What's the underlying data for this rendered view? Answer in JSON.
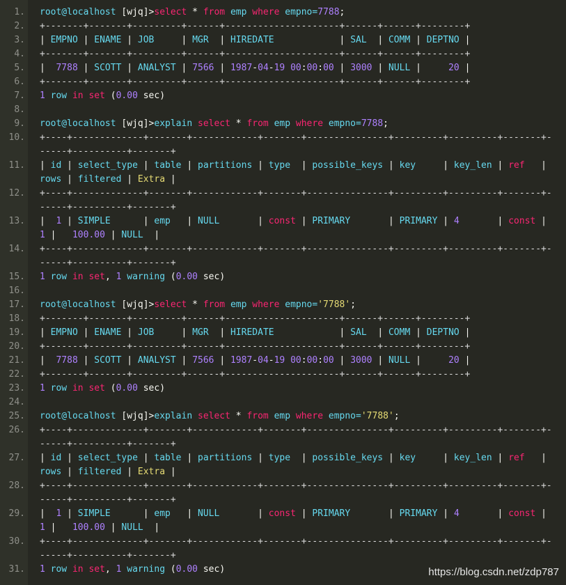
{
  "lines": [
    {
      "num": "1.",
      "tokens": [
        [
          "root@localhost ",
          "kw"
        ],
        [
          "[wjq]>",
          "plain"
        ],
        [
          "select",
          "pink"
        ],
        [
          " * ",
          "plain"
        ],
        [
          "from",
          "pink"
        ],
        [
          " emp ",
          "kw"
        ],
        [
          "where",
          "pink"
        ],
        [
          " empno=",
          "kw"
        ],
        [
          "7788",
          "num"
        ],
        [
          ";",
          "plain"
        ]
      ]
    },
    {
      "num": "2.",
      "tokens": [
        [
          "+-------+-------+---------+------+---------------------+------+------+--------+",
          "dash"
        ]
      ]
    },
    {
      "num": "3.",
      "tokens": [
        [
          "| ",
          "plain"
        ],
        [
          "EMPNO",
          "kw"
        ],
        [
          " | ",
          "plain"
        ],
        [
          "ENAME",
          "kw"
        ],
        [
          " | ",
          "plain"
        ],
        [
          "JOB",
          "kw"
        ],
        [
          "     | ",
          "plain"
        ],
        [
          "MGR",
          "kw"
        ],
        [
          "  | ",
          "plain"
        ],
        [
          "HIREDATE",
          "kw"
        ],
        [
          "            | ",
          "plain"
        ],
        [
          "SAL",
          "kw"
        ],
        [
          "  | ",
          "plain"
        ],
        [
          "COMM",
          "kw"
        ],
        [
          " | ",
          "plain"
        ],
        [
          "DEPTNO",
          "kw"
        ],
        [
          " |",
          "plain"
        ]
      ]
    },
    {
      "num": "4.",
      "tokens": [
        [
          "+-------+-------+---------+------+---------------------+------+------+--------+",
          "dash"
        ]
      ]
    },
    {
      "num": "5.",
      "tokens": [
        [
          "|  ",
          "plain"
        ],
        [
          "7788",
          "num"
        ],
        [
          " | ",
          "plain"
        ],
        [
          "SCOTT",
          "kw"
        ],
        [
          " | ",
          "plain"
        ],
        [
          "ANALYST",
          "kw"
        ],
        [
          " | ",
          "plain"
        ],
        [
          "7566",
          "num"
        ],
        [
          " | ",
          "plain"
        ],
        [
          "1987",
          "num"
        ],
        [
          "-",
          "plain"
        ],
        [
          "04",
          "num"
        ],
        [
          "-",
          "plain"
        ],
        [
          "19",
          "num"
        ],
        [
          " ",
          "plain"
        ],
        [
          "00",
          "num"
        ],
        [
          ":",
          "plain"
        ],
        [
          "00",
          "num"
        ],
        [
          ":",
          "plain"
        ],
        [
          "00",
          "num"
        ],
        [
          " | ",
          "plain"
        ],
        [
          "3000",
          "num"
        ],
        [
          " | ",
          "plain"
        ],
        [
          "NULL",
          "kw"
        ],
        [
          " |     ",
          "plain"
        ],
        [
          "20",
          "num"
        ],
        [
          " |",
          "plain"
        ]
      ]
    },
    {
      "num": "6.",
      "tokens": [
        [
          "+-------+-------+---------+------+---------------------+------+------+--------+",
          "dash"
        ]
      ]
    },
    {
      "num": "7.",
      "tokens": [
        [
          "1",
          "num"
        ],
        [
          " row ",
          "kw"
        ],
        [
          "in",
          "pink"
        ],
        [
          " ",
          "plain"
        ],
        [
          "set",
          "pink"
        ],
        [
          " (",
          "plain"
        ],
        [
          "0.00",
          "num"
        ],
        [
          " sec)",
          "plain"
        ]
      ]
    },
    {
      "num": "8.",
      "tokens": []
    },
    {
      "num": "9.",
      "tokens": [
        [
          "root@localhost ",
          "kw"
        ],
        [
          "[wjq]>",
          "plain"
        ],
        [
          "explain ",
          "kw"
        ],
        [
          "select",
          "pink"
        ],
        [
          " * ",
          "plain"
        ],
        [
          "from",
          "pink"
        ],
        [
          " emp ",
          "kw"
        ],
        [
          "where",
          "pink"
        ],
        [
          " empno=",
          "kw"
        ],
        [
          "7788",
          "num"
        ],
        [
          ";",
          "plain"
        ]
      ]
    },
    {
      "num": "10.",
      "tokens": [
        [
          "+----+-------------+-------+------------+-------+---------------+---------+---------+-------+------+----------+-------+",
          "dash"
        ]
      ]
    },
    {
      "num": "11.",
      "tokens": [
        [
          "| ",
          "plain"
        ],
        [
          "id",
          "kw"
        ],
        [
          " | ",
          "plain"
        ],
        [
          "select_type",
          "kw"
        ],
        [
          " | ",
          "plain"
        ],
        [
          "table",
          "kw"
        ],
        [
          " | ",
          "plain"
        ],
        [
          "partitions",
          "kw"
        ],
        [
          " | ",
          "plain"
        ],
        [
          "type",
          "kw"
        ],
        [
          "  | ",
          "plain"
        ],
        [
          "possible_keys",
          "kw"
        ],
        [
          " | ",
          "plain"
        ],
        [
          "key",
          "kw"
        ],
        [
          "     | ",
          "plain"
        ],
        [
          "key_len",
          "kw"
        ],
        [
          " | ",
          "plain"
        ],
        [
          "ref",
          "pink"
        ],
        [
          "   | ",
          "plain"
        ],
        [
          "rows",
          "kw"
        ],
        [
          " | ",
          "plain"
        ],
        [
          "filtered",
          "kw"
        ],
        [
          " | ",
          "plain"
        ],
        [
          "Extra",
          "str"
        ],
        [
          " |",
          "plain"
        ]
      ]
    },
    {
      "num": "12.",
      "tokens": [
        [
          "+----+-------------+-------+------------+-------+---------------+---------+---------+-------+------+----------+-------+",
          "dash"
        ]
      ]
    },
    {
      "num": "13.",
      "tokens": [
        [
          "|  ",
          "plain"
        ],
        [
          "1",
          "num"
        ],
        [
          " | ",
          "plain"
        ],
        [
          "SIMPLE",
          "kw"
        ],
        [
          "      | ",
          "plain"
        ],
        [
          "emp",
          "kw"
        ],
        [
          "   | ",
          "plain"
        ],
        [
          "NULL",
          "kw"
        ],
        [
          "       | ",
          "plain"
        ],
        [
          "const",
          "pink"
        ],
        [
          " | ",
          "plain"
        ],
        [
          "PRIMARY",
          "kw"
        ],
        [
          "       | ",
          "plain"
        ],
        [
          "PRIMARY",
          "kw"
        ],
        [
          " | ",
          "plain"
        ],
        [
          "4",
          "num"
        ],
        [
          "       | ",
          "plain"
        ],
        [
          "const",
          "pink"
        ],
        [
          " |    ",
          "plain"
        ],
        [
          "1",
          "num"
        ],
        [
          " |   ",
          "plain"
        ],
        [
          "100.00",
          "num"
        ],
        [
          " | ",
          "plain"
        ],
        [
          "NULL",
          "kw"
        ],
        [
          "  |",
          "plain"
        ]
      ]
    },
    {
      "num": "14.",
      "tokens": [
        [
          "+----+-------------+-------+------------+-------+---------------+---------+---------+-------+------+----------+-------+",
          "dash"
        ]
      ]
    },
    {
      "num": "15.",
      "tokens": [
        [
          "1",
          "num"
        ],
        [
          " row ",
          "kw"
        ],
        [
          "in",
          "pink"
        ],
        [
          " ",
          "plain"
        ],
        [
          "set",
          "pink"
        ],
        [
          ", ",
          "plain"
        ],
        [
          "1",
          "num"
        ],
        [
          " warning ",
          "kw"
        ],
        [
          "(",
          "plain"
        ],
        [
          "0.00",
          "num"
        ],
        [
          " sec)",
          "plain"
        ]
      ]
    },
    {
      "num": "16.",
      "tokens": []
    },
    {
      "num": "17.",
      "tokens": [
        [
          "root@localhost ",
          "kw"
        ],
        [
          "[wjq]>",
          "plain"
        ],
        [
          "select",
          "pink"
        ],
        [
          " * ",
          "plain"
        ],
        [
          "from",
          "pink"
        ],
        [
          " emp ",
          "kw"
        ],
        [
          "where",
          "pink"
        ],
        [
          " empno=",
          "kw"
        ],
        [
          "'7788'",
          "str"
        ],
        [
          ";",
          "plain"
        ]
      ]
    },
    {
      "num": "18.",
      "tokens": [
        [
          "+-------+-------+---------+------+---------------------+------+------+--------+",
          "dash"
        ]
      ]
    },
    {
      "num": "19.",
      "tokens": [
        [
          "| ",
          "plain"
        ],
        [
          "EMPNO",
          "kw"
        ],
        [
          " | ",
          "plain"
        ],
        [
          "ENAME",
          "kw"
        ],
        [
          " | ",
          "plain"
        ],
        [
          "JOB",
          "kw"
        ],
        [
          "     | ",
          "plain"
        ],
        [
          "MGR",
          "kw"
        ],
        [
          "  | ",
          "plain"
        ],
        [
          "HIREDATE",
          "kw"
        ],
        [
          "            | ",
          "plain"
        ],
        [
          "SAL",
          "kw"
        ],
        [
          "  | ",
          "plain"
        ],
        [
          "COMM",
          "kw"
        ],
        [
          " | ",
          "plain"
        ],
        [
          "DEPTNO",
          "kw"
        ],
        [
          " |",
          "plain"
        ]
      ]
    },
    {
      "num": "20.",
      "tokens": [
        [
          "+-------+-------+---------+------+---------------------+------+------+--------+",
          "dash"
        ]
      ]
    },
    {
      "num": "21.",
      "tokens": [
        [
          "|  ",
          "plain"
        ],
        [
          "7788",
          "num"
        ],
        [
          " | ",
          "plain"
        ],
        [
          "SCOTT",
          "kw"
        ],
        [
          " | ",
          "plain"
        ],
        [
          "ANALYST",
          "kw"
        ],
        [
          " | ",
          "plain"
        ],
        [
          "7566",
          "num"
        ],
        [
          " | ",
          "plain"
        ],
        [
          "1987",
          "num"
        ],
        [
          "-",
          "plain"
        ],
        [
          "04",
          "num"
        ],
        [
          "-",
          "plain"
        ],
        [
          "19",
          "num"
        ],
        [
          " ",
          "plain"
        ],
        [
          "00",
          "num"
        ],
        [
          ":",
          "plain"
        ],
        [
          "00",
          "num"
        ],
        [
          ":",
          "plain"
        ],
        [
          "00",
          "num"
        ],
        [
          " | ",
          "plain"
        ],
        [
          "3000",
          "num"
        ],
        [
          " | ",
          "plain"
        ],
        [
          "NULL",
          "kw"
        ],
        [
          " |     ",
          "plain"
        ],
        [
          "20",
          "num"
        ],
        [
          " |",
          "plain"
        ]
      ]
    },
    {
      "num": "22.",
      "tokens": [
        [
          "+-------+-------+---------+------+---------------------+------+------+--------+",
          "dash"
        ]
      ]
    },
    {
      "num": "23.",
      "tokens": [
        [
          "1",
          "num"
        ],
        [
          " row ",
          "kw"
        ],
        [
          "in",
          "pink"
        ],
        [
          " ",
          "plain"
        ],
        [
          "set",
          "pink"
        ],
        [
          " (",
          "plain"
        ],
        [
          "0.00",
          "num"
        ],
        [
          " sec)",
          "plain"
        ]
      ]
    },
    {
      "num": "24.",
      "tokens": []
    },
    {
      "num": "25.",
      "tokens": [
        [
          "root@localhost ",
          "kw"
        ],
        [
          "[wjq]>",
          "plain"
        ],
        [
          "explain ",
          "kw"
        ],
        [
          "select",
          "pink"
        ],
        [
          " * ",
          "plain"
        ],
        [
          "from",
          "pink"
        ],
        [
          " emp ",
          "kw"
        ],
        [
          "where",
          "pink"
        ],
        [
          " empno=",
          "kw"
        ],
        [
          "'7788'",
          "str"
        ],
        [
          ";",
          "plain"
        ]
      ]
    },
    {
      "num": "26.",
      "tokens": [
        [
          "+----+-------------+-------+------------+-------+---------------+---------+---------+-------+------+----------+-------+",
          "dash"
        ]
      ]
    },
    {
      "num": "27.",
      "tokens": [
        [
          "| ",
          "plain"
        ],
        [
          "id",
          "kw"
        ],
        [
          " | ",
          "plain"
        ],
        [
          "select_type",
          "kw"
        ],
        [
          " | ",
          "plain"
        ],
        [
          "table",
          "kw"
        ],
        [
          " | ",
          "plain"
        ],
        [
          "partitions",
          "kw"
        ],
        [
          " | ",
          "plain"
        ],
        [
          "type",
          "kw"
        ],
        [
          "  | ",
          "plain"
        ],
        [
          "possible_keys",
          "kw"
        ],
        [
          " | ",
          "plain"
        ],
        [
          "key",
          "kw"
        ],
        [
          "     | ",
          "plain"
        ],
        [
          "key_len",
          "kw"
        ],
        [
          " | ",
          "plain"
        ],
        [
          "ref",
          "pink"
        ],
        [
          "   | ",
          "plain"
        ],
        [
          "rows",
          "kw"
        ],
        [
          " | ",
          "plain"
        ],
        [
          "filtered",
          "kw"
        ],
        [
          " | ",
          "plain"
        ],
        [
          "Extra",
          "str"
        ],
        [
          " |",
          "plain"
        ]
      ]
    },
    {
      "num": "28.",
      "tokens": [
        [
          "+----+-------------+-------+------------+-------+---------------+---------+---------+-------+------+----------+-------+",
          "dash"
        ]
      ]
    },
    {
      "num": "29.",
      "tokens": [
        [
          "|  ",
          "plain"
        ],
        [
          "1",
          "num"
        ],
        [
          " | ",
          "plain"
        ],
        [
          "SIMPLE",
          "kw"
        ],
        [
          "      | ",
          "plain"
        ],
        [
          "emp",
          "kw"
        ],
        [
          "   | ",
          "plain"
        ],
        [
          "NULL",
          "kw"
        ],
        [
          "       | ",
          "plain"
        ],
        [
          "const",
          "pink"
        ],
        [
          " | ",
          "plain"
        ],
        [
          "PRIMARY",
          "kw"
        ],
        [
          "       | ",
          "plain"
        ],
        [
          "PRIMARY",
          "kw"
        ],
        [
          " | ",
          "plain"
        ],
        [
          "4",
          "num"
        ],
        [
          "       | ",
          "plain"
        ],
        [
          "const",
          "pink"
        ],
        [
          " |    ",
          "plain"
        ],
        [
          "1",
          "num"
        ],
        [
          " |   ",
          "plain"
        ],
        [
          "100.00",
          "num"
        ],
        [
          " | ",
          "plain"
        ],
        [
          "NULL",
          "kw"
        ],
        [
          "  |",
          "plain"
        ]
      ]
    },
    {
      "num": "30.",
      "tokens": [
        [
          "+----+-------------+-------+------------+-------+---------------+---------+---------+-------+------+----------+-------+",
          "dash"
        ]
      ]
    },
    {
      "num": "31.",
      "tokens": [
        [
          "1",
          "num"
        ],
        [
          " row ",
          "kw"
        ],
        [
          "in",
          "pink"
        ],
        [
          " ",
          "plain"
        ],
        [
          "set",
          "pink"
        ],
        [
          ", ",
          "plain"
        ],
        [
          "1",
          "num"
        ],
        [
          " warning ",
          "kw"
        ],
        [
          "(",
          "plain"
        ],
        [
          "0.00",
          "num"
        ],
        [
          " sec)",
          "plain"
        ]
      ]
    }
  ],
  "watermark": "https://blog.csdn.net/zdp787",
  "colors": {
    "background": "#272822",
    "gutter": "#2f3129",
    "keyword": "#66d9ef",
    "pink": "#f92672",
    "number": "#ae81ff",
    "string": "#e6db74"
  }
}
